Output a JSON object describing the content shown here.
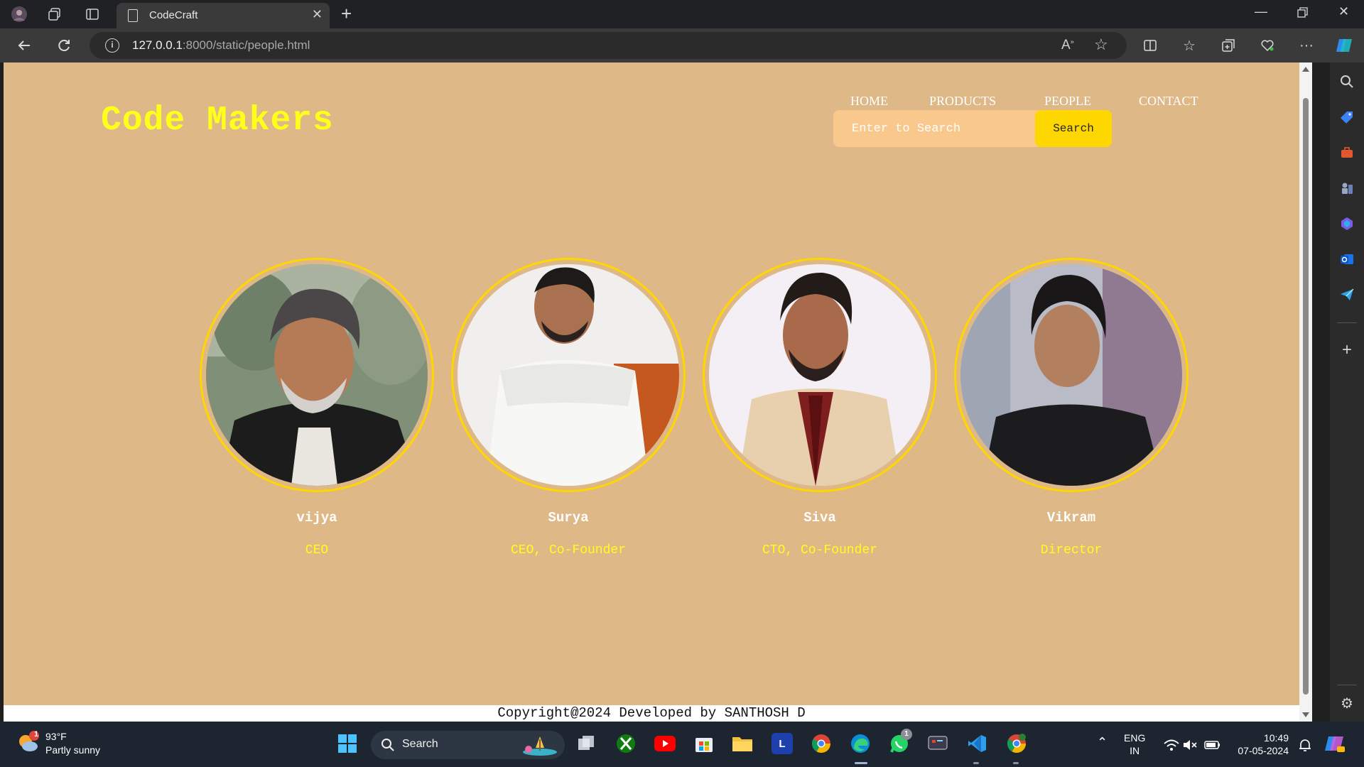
{
  "browser": {
    "tab_title": "CodeCraft",
    "url_host": "127.0.0.1",
    "url_rest": ":8000/static/people.html"
  },
  "site": {
    "logo": "Code Makers",
    "nav": [
      "HOME",
      "PRODUCTS",
      "PEOPLE",
      "CONTACT"
    ],
    "search_placeholder": "Enter to Search",
    "search_button": "Search",
    "people": [
      {
        "name": "vijya",
        "role": "CEO"
      },
      {
        "name": "Surya",
        "role": "CEO, Co-Founder"
      },
      {
        "name": "Siva",
        "role": "CTO, Co-Founder"
      },
      {
        "name": "Vikram",
        "role": "Director"
      }
    ],
    "footer": "Copyright@2024 Developed by SANTHOSH D"
  },
  "taskbar": {
    "weather_temp": "93°F",
    "weather_desc": "Partly sunny",
    "weather_badge": "1",
    "search_label": "Search",
    "lang_top": "ENG",
    "lang_bottom": "IN",
    "time": "10:49",
    "date": "07-05-2024",
    "whatsapp_badge": "1"
  },
  "colors": {
    "page_bg": "#deb887",
    "accent_yellow": "#ffff1a",
    "ring_gold": "#ffd700",
    "search_bg": "#f9c88c"
  }
}
